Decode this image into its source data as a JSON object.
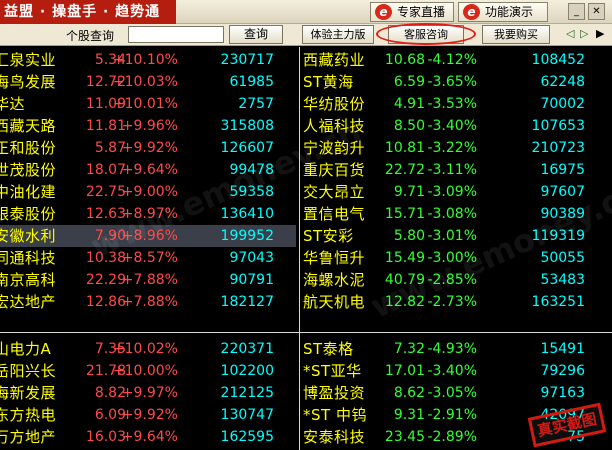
{
  "titlebar": {
    "brand": "益盟 · 操盘手 · 趋势通",
    "buttons": [
      {
        "label": "专家直播",
        "icon": "e-icon"
      },
      {
        "label": "功能演示",
        "icon": "e-icon"
      }
    ],
    "window_controls": [
      "_",
      "✕"
    ]
  },
  "toolbar": {
    "search_label": "个股查询",
    "search_value": "",
    "query_button": "查询",
    "buttons": [
      "体验主力版",
      "客服咨询",
      "我要购买"
    ]
  },
  "top_left": [
    {
      "name": "汇泉实业",
      "price": "5.34",
      "change": "+10.10%",
      "volume": "230717"
    },
    {
      "name": "海鸟发展",
      "price": "12.72",
      "change": "+10.03%",
      "volume": "61985"
    },
    {
      "name": "华达",
      "price": "11.09",
      "change": "+10.01%",
      "volume": "2757"
    },
    {
      "name": "西藏天路",
      "price": "11.81",
      "change": "+9.96%",
      "volume": "315808"
    },
    {
      "name": "正和股份",
      "price": "5.87",
      "change": "+9.92%",
      "volume": "126607"
    },
    {
      "name": "世茂股份",
      "price": "18.07",
      "change": "+9.64%",
      "volume": "99478"
    },
    {
      "name": "中油化建",
      "price": "22.75",
      "change": "+9.00%",
      "volume": "59358"
    },
    {
      "name": "银泰股份",
      "price": "12.63",
      "change": "+8.97%",
      "volume": "136410"
    },
    {
      "name": "安徽水利",
      "price": "7.90",
      "change": "+8.96%",
      "volume": "199952"
    },
    {
      "name": "同通科技",
      "price": "10.38",
      "change": "+8.57%",
      "volume": "97043"
    },
    {
      "name": "南京高科",
      "price": "22.29",
      "change": "+7.88%",
      "volume": "90791"
    },
    {
      "name": "宏达地产",
      "price": "12.86",
      "change": "+7.88%",
      "volume": "182127"
    }
  ],
  "top_right": [
    {
      "name": "西藏药业",
      "price": "10.68",
      "change": "-4.12%",
      "volume": "108452"
    },
    {
      "name": "ST黄海",
      "price": "6.59",
      "change": "-3.65%",
      "volume": "62248"
    },
    {
      "name": "华纺股份",
      "price": "4.91",
      "change": "-3.53%",
      "volume": "70002"
    },
    {
      "name": "人福科技",
      "price": "8.50",
      "change": "-3.40%",
      "volume": "107653"
    },
    {
      "name": "宁波韵升",
      "price": "10.81",
      "change": "-3.22%",
      "volume": "210723"
    },
    {
      "name": "重庆百货",
      "price": "22.72",
      "change": "-3.11%",
      "volume": "16975"
    },
    {
      "name": "交大昂立",
      "price": "9.71",
      "change": "-3.09%",
      "volume": "97607"
    },
    {
      "name": "置信电气",
      "price": "15.71",
      "change": "-3.08%",
      "volume": "90389"
    },
    {
      "name": "ST安彩",
      "price": "5.80",
      "change": "-3.01%",
      "volume": "119319"
    },
    {
      "name": "华鲁恒升",
      "price": "15.49",
      "change": "-3.00%",
      "volume": "50055"
    },
    {
      "name": "海螺水泥",
      "price": "40.79",
      "change": "-2.85%",
      "volume": "53483"
    },
    {
      "name": "航天机电",
      "price": "12.82",
      "change": "-2.73%",
      "volume": "163251"
    }
  ],
  "bottom_left": [
    {
      "name": "山电力A",
      "price": "7.35",
      "change": "+10.02%",
      "volume": "220371"
    },
    {
      "name": "岳阳兴长",
      "price": "21.78",
      "change": "+10.00%",
      "volume": "102200"
    },
    {
      "name": "海新发展",
      "price": "8.82",
      "change": "+9.97%",
      "volume": "212125"
    },
    {
      "name": "东方热电",
      "price": "6.09",
      "change": "+9.92%",
      "volume": "130747"
    },
    {
      "name": "万方地产",
      "price": "16.03",
      "change": "+9.64%",
      "volume": "162595"
    }
  ],
  "bottom_right": [
    {
      "name": "ST泰格",
      "price": "7.32",
      "change": "-4.93%",
      "volume": "15491"
    },
    {
      "name": "*ST亚华",
      "price": "17.01",
      "change": "-3.40%",
      "volume": "79296"
    },
    {
      "name": "博盈投资",
      "price": "8.62",
      "change": "-3.05%",
      "volume": "97163"
    },
    {
      "name": "*ST 中钨",
      "price": "9.31",
      "change": "-2.91%",
      "volume": "42097"
    },
    {
      "name": "安泰科技",
      "price": "23.45",
      "change": "-2.89%",
      "volume": "75"
    }
  ],
  "highlight": {
    "panel": "top_left",
    "index": 8,
    "color": "#3a3f4a"
  },
  "colors": {
    "up": "#ff4a4a",
    "down": "#33ff33",
    "name": "#ffff00",
    "volume": "#00ffff",
    "brand": "#b51d0f"
  },
  "stamp_text": "真实截图"
}
